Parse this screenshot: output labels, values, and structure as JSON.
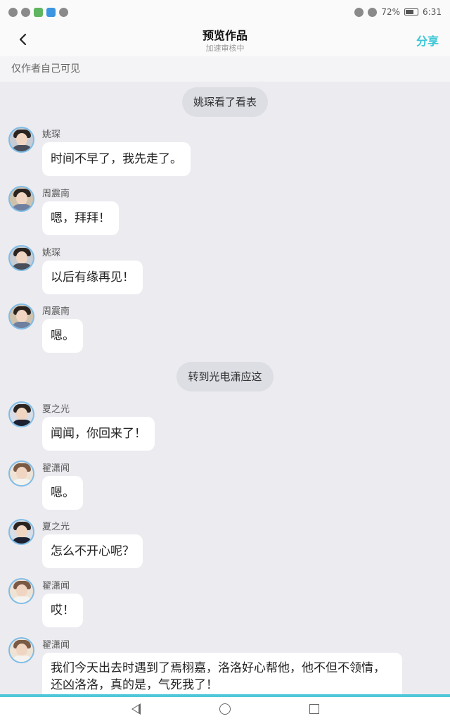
{
  "status_bar": {
    "battery_percent": "72%",
    "battery_level": 0.72,
    "time": "6:31"
  },
  "nav": {
    "title": "预览作品",
    "subtitle": "加速审核中",
    "share_label": "分享"
  },
  "notice": "仅作者自己可见",
  "narration": [
    "姚琛看了看表",
    "转到光电潇应这"
  ],
  "messages": [
    {
      "sender": "姚琛",
      "text": "时间不早了，我先走了。"
    },
    {
      "sender": "周震南",
      "text": "嗯，拜拜！"
    },
    {
      "sender": "姚琛",
      "text": "以后有缘再见！"
    },
    {
      "sender": "周震南",
      "text": "嗯。"
    },
    {
      "sender": "夏之光",
      "text": "闻闻，你回来了！"
    },
    {
      "sender": "翟潇闻",
      "text": "嗯。"
    },
    {
      "sender": "夏之光",
      "text": "怎么不开心呢？"
    },
    {
      "sender": "翟潇闻",
      "text": "哎！"
    },
    {
      "sender": "翟潇闻",
      "text": "我们今天出去时遇到了焉栩嘉，洛洛好心帮他，他不但不领情，还凶洛洛，真的是，气死我了！"
    }
  ]
}
